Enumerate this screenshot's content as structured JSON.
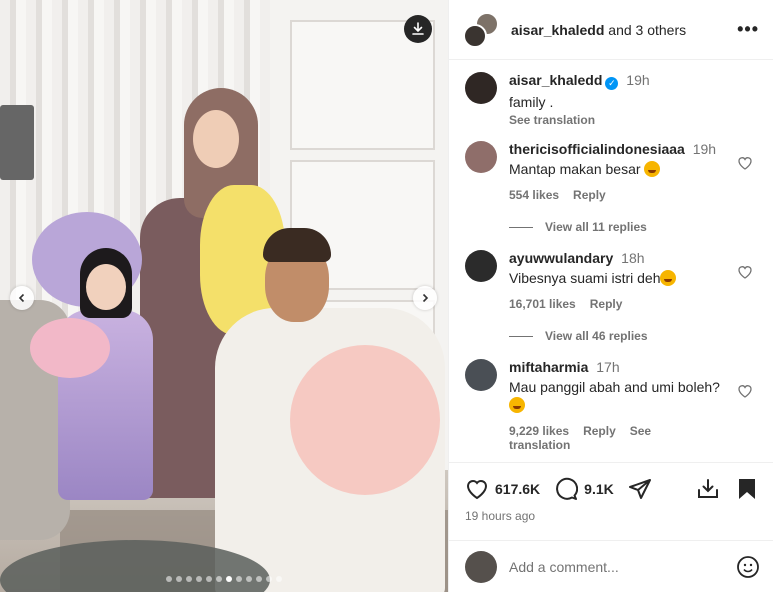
{
  "post": {
    "header": {
      "username": "aisar_khaledd",
      "others": "and 3 others",
      "more": "•••"
    },
    "caption": {
      "username": "aisar_khaledd",
      "time": "19h",
      "text": "family .",
      "translate": "See translation"
    },
    "comments": [
      {
        "username": "thericisofficialindonesiaaa",
        "time": "19h",
        "text": "Mantap makan besar",
        "likes": "554 likes",
        "reply": "Reply",
        "view_replies": "View all 11 replies",
        "avatar_color": "#8f6e6a"
      },
      {
        "username": "ayuwwulandary",
        "time": "18h",
        "text": "Vibesnya suami istri deh",
        "likes": "16,701 likes",
        "reply": "Reply",
        "view_replies": "View all 46 replies",
        "avatar_color": "#2b2b2b"
      },
      {
        "username": "miftaharmia",
        "time": "17h",
        "text": "Mau panggil abah and umi boleh?",
        "likes": "9,229 likes",
        "reply": "Reply",
        "translate": "See translation",
        "avatar_color": "#4a4f55"
      }
    ],
    "actions": {
      "likes_count": "617.6K",
      "comments_count": "9.1K"
    },
    "posted_ago": "19 hours ago",
    "add_comment_placeholder": "Add a comment..."
  },
  "carousel": {
    "total_slides": 12,
    "active_index": 6
  },
  "colors": {
    "accent": "#0095f6",
    "secondary_text": "#737373",
    "primary_text": "#262626"
  }
}
